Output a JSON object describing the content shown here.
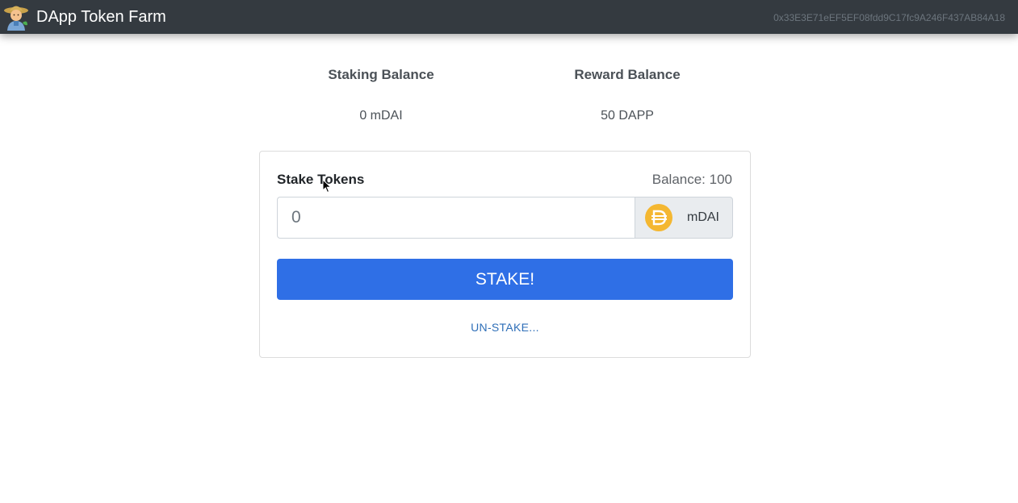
{
  "navbar": {
    "title": "DApp Token Farm",
    "logo_icon": "farmer-emoji-icon",
    "account": "0x33E3E71eEF5EF08fdd9C17fc9A246F437AB84A18"
  },
  "balances": {
    "staking_heading": "Staking Balance",
    "staking_value": "0 mDAI",
    "reward_heading": "Reward Balance",
    "reward_value": "50 DAPP"
  },
  "stake_form": {
    "title": "Stake Tokens",
    "balance": "Balance: 100",
    "amount_placeholder": "0",
    "token_icon": "dai-coin-icon",
    "token_label": "mDAI",
    "stake_button": "STAKE!",
    "unstake_link": "UN-STAKE..."
  },
  "colors": {
    "navbar_bg": "#343a40",
    "primary_button": "#2f6fe6",
    "link": "#2f6fb8",
    "dai_coin": "#f4b731"
  }
}
